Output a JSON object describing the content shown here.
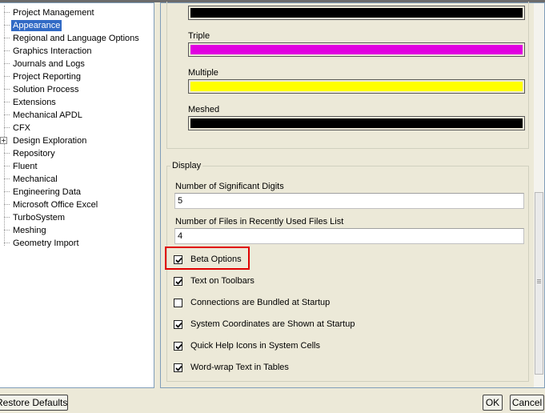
{
  "tree": {
    "items": [
      {
        "label": "Project Management"
      },
      {
        "label": "Appearance",
        "selected": true
      },
      {
        "label": "Regional and Language Options"
      },
      {
        "label": "Graphics Interaction"
      },
      {
        "label": "Journals and Logs"
      },
      {
        "label": "Project Reporting"
      },
      {
        "label": "Solution Process"
      },
      {
        "label": "Extensions"
      },
      {
        "label": "Mechanical APDL"
      },
      {
        "label": "CFX"
      },
      {
        "label": "Design Exploration",
        "expandable": true
      },
      {
        "label": "Repository"
      },
      {
        "label": "Fluent"
      },
      {
        "label": "Mechanical"
      },
      {
        "label": "Engineering Data"
      },
      {
        "label": "Microsoft Office Excel"
      },
      {
        "label": "TurboSystem"
      },
      {
        "label": "Meshing"
      },
      {
        "label": "Geometry Import"
      }
    ],
    "expand_symbol": "+"
  },
  "colors": {
    "top_bar": "#000000",
    "triple": {
      "label": "Triple",
      "color": "#e000e0"
    },
    "multiple": {
      "label": "Multiple",
      "color": "#ffff00"
    },
    "meshed": {
      "label": "Meshed",
      "color": "#000000"
    }
  },
  "display": {
    "title": "Display",
    "sig_digits": {
      "label": "Number of Significant Digits",
      "value": "5"
    },
    "recent_files": {
      "label": "Number of Files in Recently Used Files List",
      "value": "4"
    },
    "checkboxes": [
      {
        "label": "Beta Options",
        "checked": true
      },
      {
        "label": "Text on Toolbars",
        "checked": true
      },
      {
        "label": "Connections are Bundled at Startup",
        "checked": false
      },
      {
        "label": "System Coordinates are Shown at Startup",
        "checked": true
      },
      {
        "label": "Quick Help Icons in System Cells",
        "checked": true
      },
      {
        "label": "Word-wrap Text in Tables",
        "checked": true
      }
    ]
  },
  "buttons": {
    "restore": "Restore Defaults",
    "ok": "OK",
    "cancel": "Cancel"
  }
}
